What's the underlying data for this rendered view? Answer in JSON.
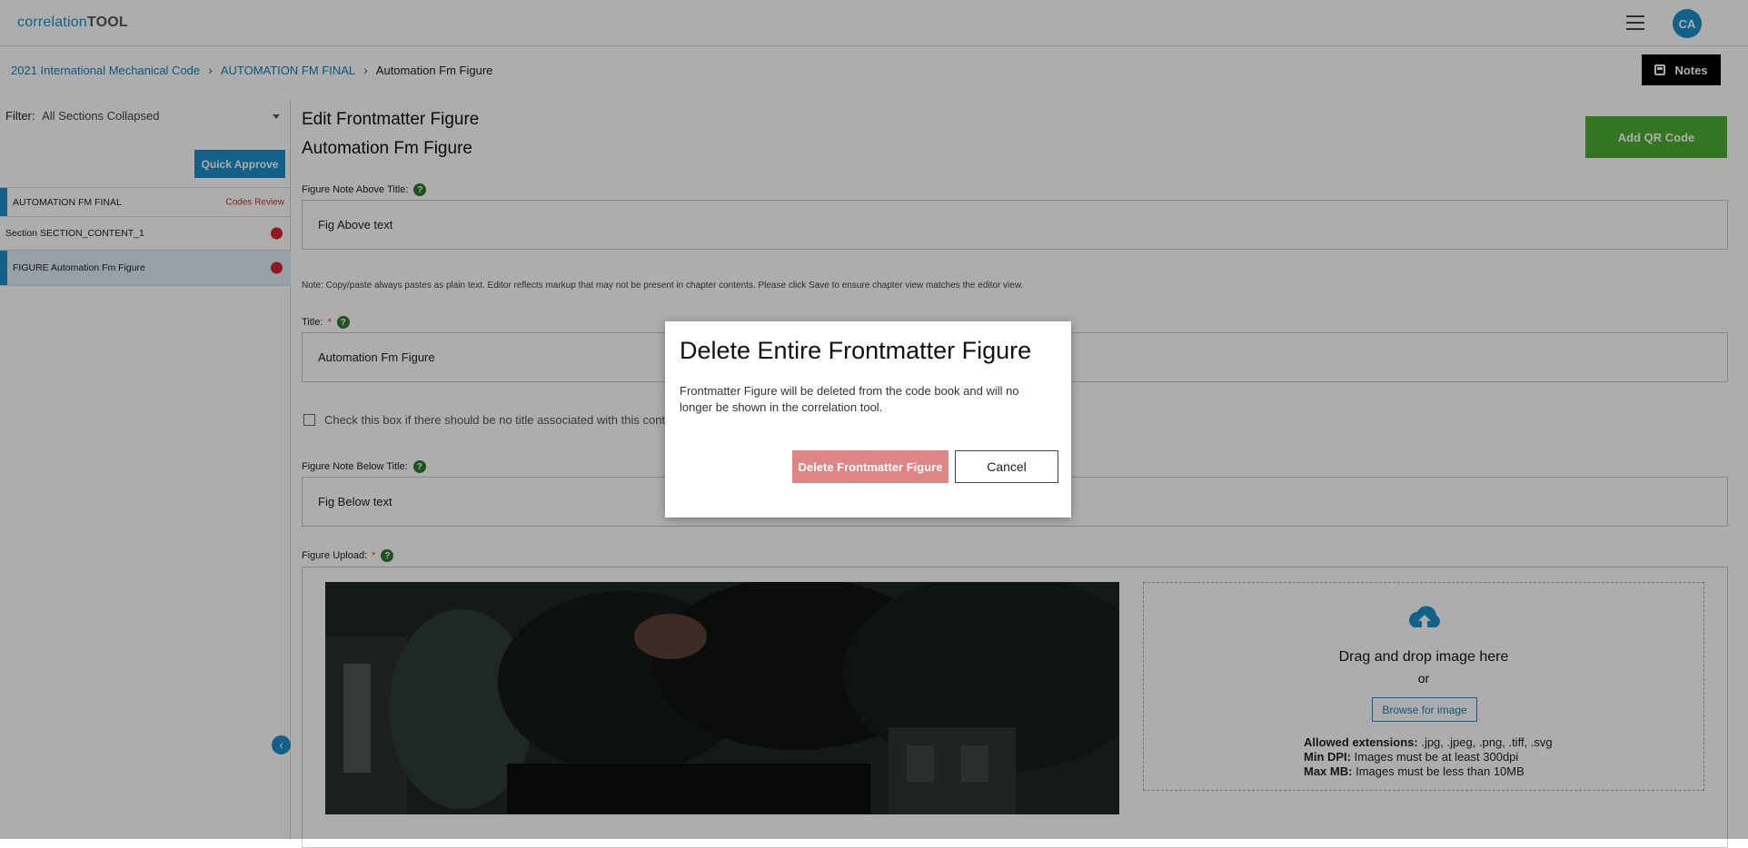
{
  "app": {
    "logo_part1": "correlation",
    "logo_part2": "TOOL",
    "avatar_initials": "CA",
    "accent_color": "#1a8fc9"
  },
  "breadcrumb": {
    "items": [
      "2021 International Mechanical Code",
      "AUTOMATION FM FINAL"
    ],
    "current": "Automation Fm Figure"
  },
  "header": {
    "notes_label": "Notes"
  },
  "sidebar": {
    "filter_label": "Filter:",
    "filter_value": "All Sections Collapsed",
    "quick_approve_label": "Quick Approve",
    "items": [
      {
        "label": "AUTOMATION FM FINAL",
        "status": "Codes Review"
      },
      {
        "label": "Section SECTION_CONTENT_1",
        "status_color": "#d9232d"
      },
      {
        "label": "FIGURE Automation Fm Figure",
        "status_color": "#d9232d"
      }
    ]
  },
  "main": {
    "title": "Edit Frontmatter Figure",
    "subtitle": "Automation Fm Figure",
    "qr_button": "Add QR Code",
    "qr_color": "#4caf32",
    "above_label": "Figure Note Above Title:",
    "above_value": "Fig Above text",
    "note_text": "Note: Copy/paste always pastes as plain text. Editor reflects markup that may not be present in chapter contents. Please click Save to ensure chapter view matches the editor view.",
    "title_label": "Title:",
    "required_mark": "*",
    "title_value": "Automation Fm Figure",
    "no_title_checkbox_label": "Check this box if there should be no title associated with this content",
    "below_label": "Figure Note Below Title:",
    "below_value": "Fig Below text",
    "upload_label": "Figure Upload:",
    "help_glyph": "?",
    "dropzone": {
      "title": "Drag and drop image here",
      "or": "or",
      "browse": "Browse for image",
      "ext_label": "Allowed extensions:",
      "ext_value": ".jpg, .jpeg, .png, .tiff, .svg",
      "dpi_label": "Min DPI:",
      "dpi_value": "Images must be at least 300dpi",
      "mb_label": "Max MB:",
      "mb_value": "Images must be less than 10MB"
    }
  },
  "modal": {
    "title": "Delete Entire Frontmatter Figure",
    "body": "Frontmatter Figure will be deleted from the code book and will no longer be shown in the correlation tool.",
    "confirm_label": "Delete Frontmatter Figure",
    "cancel_label": "Cancel"
  }
}
